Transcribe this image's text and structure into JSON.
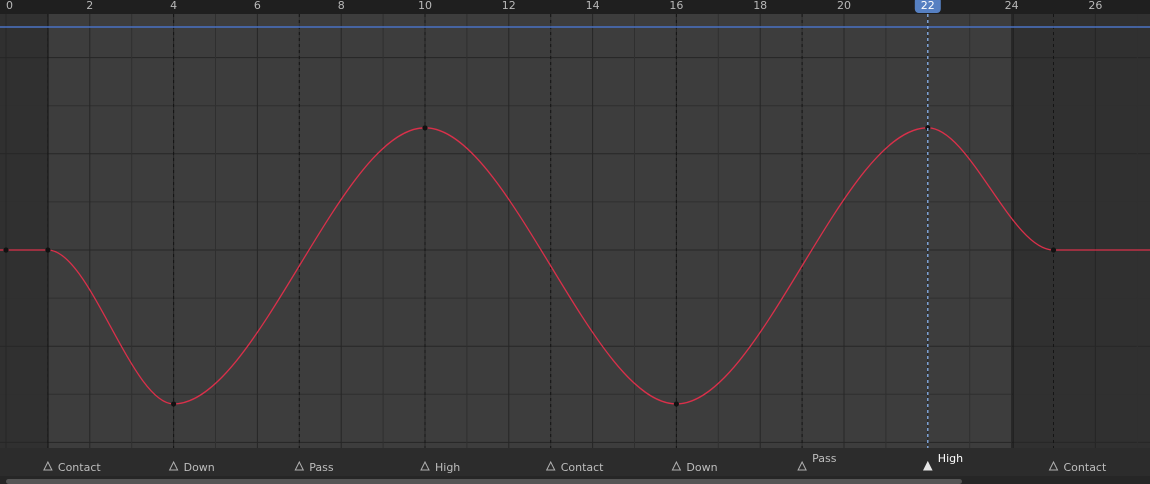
{
  "editor": {
    "type": "graph-editor",
    "current_frame": 22,
    "preview_range": {
      "start": 1,
      "end": 24
    }
  },
  "ruler": {
    "labels": [
      "0",
      "2",
      "4",
      "6",
      "8",
      "10",
      "12",
      "14",
      "16",
      "18",
      "20",
      "22",
      "24",
      "26"
    ]
  },
  "markers": [
    {
      "frame": 1,
      "label": "Contact",
      "selected": false
    },
    {
      "frame": 4,
      "label": "Down",
      "selected": false
    },
    {
      "frame": 7,
      "label": "Pass",
      "selected": false
    },
    {
      "frame": 10,
      "label": "High",
      "selected": false
    },
    {
      "frame": 13,
      "label": "Contact",
      "selected": false
    },
    {
      "frame": 16,
      "label": "Down",
      "selected": false
    },
    {
      "frame": 19,
      "label": "Pass",
      "selected": false,
      "raised": true
    },
    {
      "frame": 22,
      "label": "High",
      "selected": true,
      "raised": true
    },
    {
      "frame": 25,
      "label": "Contact",
      "selected": false
    }
  ],
  "fcurve": {
    "color": "#d9304a",
    "keyframes": [
      {
        "frame": 0,
        "value": 0
      },
      {
        "frame": 1,
        "value": 0
      },
      {
        "frame": 4,
        "value": -1.6
      },
      {
        "frame": 10,
        "value": 1.27
      },
      {
        "frame": 16,
        "value": -1.6
      },
      {
        "frame": 22,
        "value": 1.27
      },
      {
        "frame": 25,
        "value": 0
      }
    ]
  },
  "colors": {
    "background": "#303030",
    "preview_area": "#3d3d3d",
    "ruler_bg": "#1f1f1f",
    "playhead": "#5680c2",
    "playhead_line": "#8ab4f0",
    "guide_line": "#4a72c4"
  }
}
